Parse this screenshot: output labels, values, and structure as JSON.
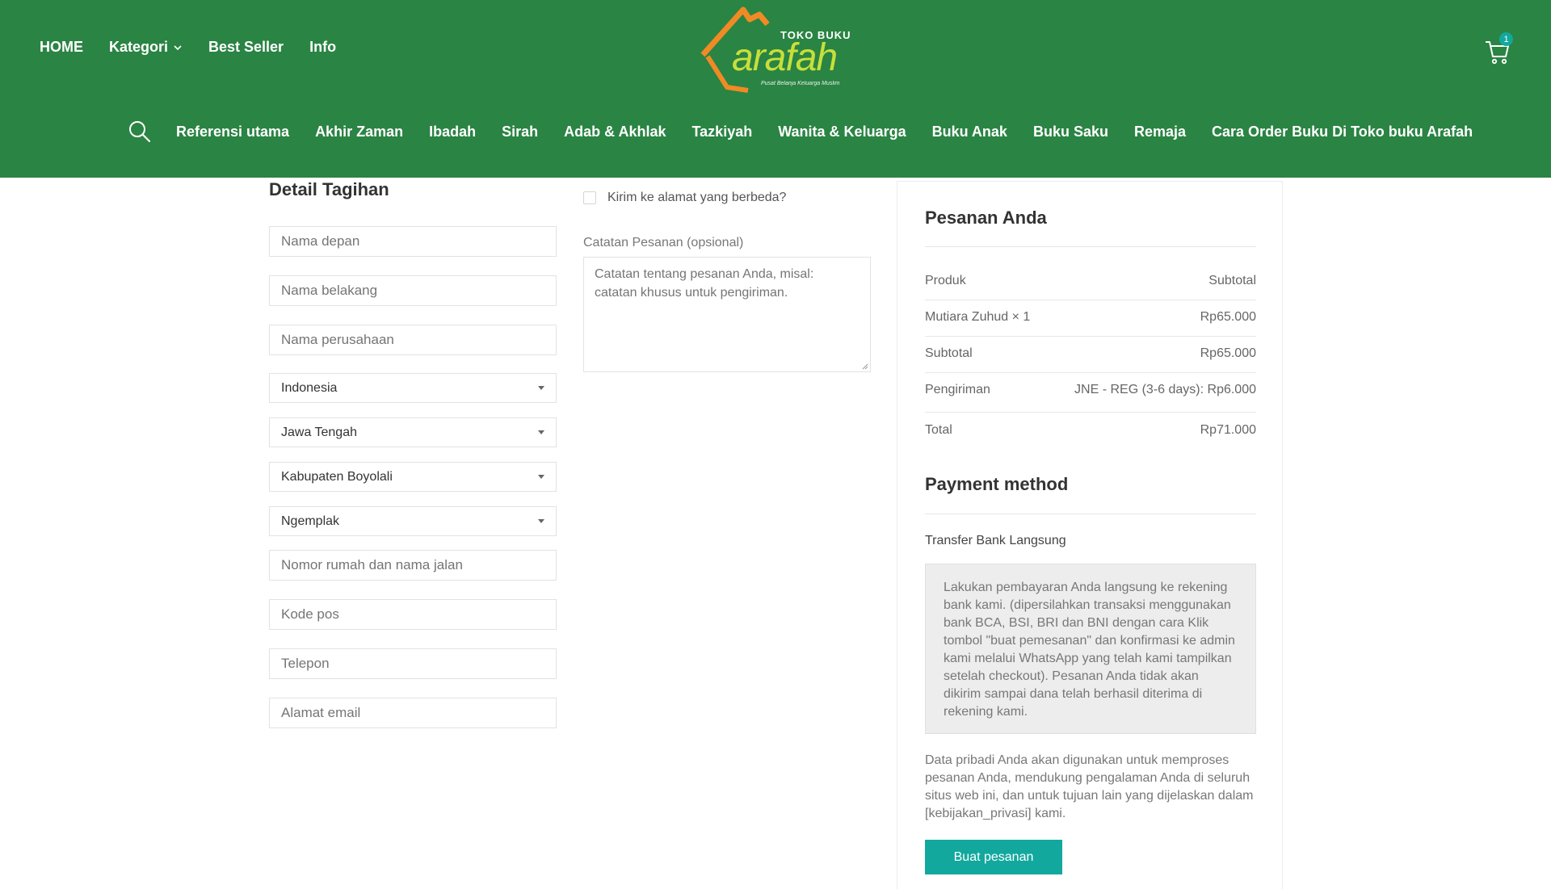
{
  "header": {
    "nav": [
      {
        "label": "HOME"
      },
      {
        "label": "Kategori"
      },
      {
        "label": "Best Seller"
      },
      {
        "label": "Info"
      }
    ],
    "logo": {
      "top_text": "TOKO BUKU",
      "brand": "arafah",
      "tagline": "Pusat Belanja Keluarga Muslim"
    },
    "cart_count": "1",
    "categories": [
      "Referensi utama",
      "Akhir Zaman",
      "Ibadah",
      "Sirah",
      "Adab & Akhlak",
      "Tazkiyah",
      "Wanita & Keluarga",
      "Buku Anak",
      "Buku Saku",
      "Remaja",
      "Cara Order Buku Di Toko buku Arafah"
    ]
  },
  "billing": {
    "title": "Detail Tagihan",
    "first_name_placeholder": "Nama depan",
    "last_name_placeholder": "Nama belakang",
    "company_placeholder": "Nama perusahaan",
    "country": "Indonesia",
    "province": "Jawa Tengah",
    "city": "Kabupaten Boyolali",
    "district": "Ngemplak",
    "address_placeholder": "Nomor rumah dan nama jalan",
    "postcode_placeholder": "Kode pos",
    "phone_placeholder": "Telepon",
    "email_placeholder": "Alamat email"
  },
  "shipping": {
    "different_address_label": "Kirim ke alamat yang berbeda?",
    "notes_label": "Catatan Pesanan (opsional)",
    "notes_placeholder": "Catatan tentang pesanan Anda, misal: catatan khusus untuk pengiriman."
  },
  "order": {
    "title": "Pesanan Anda",
    "product_header": "Produk",
    "subtotal_header": "Subtotal",
    "item_name": "Mutiara Zuhud  × 1",
    "item_price": "Rp65.000",
    "subtotal_label": "Subtotal",
    "subtotal_value": "Rp65.000",
    "shipping_label": "Pengiriman",
    "shipping_value": "JNE - REG (3-6 days): Rp6.000",
    "total_label": "Total",
    "total_value": "Rp71.000"
  },
  "payment": {
    "title": "Payment method",
    "method_label": "Transfer Bank Langsung",
    "method_description": "Lakukan pembayaran Anda langsung ke rekening bank kami. (dipersilahkan transaksi menggunakan bank BCA, BSI, BRI dan BNI dengan cara Klik tombol \"buat pemesanan\" dan konfirmasi ke admin kami melalui WhatsApp yang telah kami tampilkan setelah checkout). Pesanan Anda tidak akan dikirim sampai dana telah berhasil diterima di rekening kami.",
    "privacy_text": "Data pribadi Anda akan digunakan untuk memproses pesanan Anda, mendukung pengalaman Anda di seluruh situs web ini, dan untuk tujuan lain yang dijelaskan dalam [kebijakan_privasi] kami.",
    "place_order_label": "Buat pesanan"
  },
  "colors": {
    "header_green": "#2a8443",
    "accent_teal": "#13a89e",
    "logo_orange": "#f08a24",
    "logo_lime": "#c8df3a"
  }
}
